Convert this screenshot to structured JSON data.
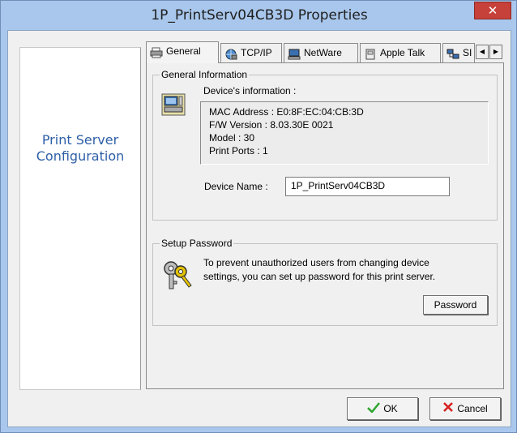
{
  "window": {
    "title": "1P_PrintServ04CB3D Properties",
    "close_glyph": "✕"
  },
  "left_panel": {
    "line1": "Print Server",
    "line2": "Configuration"
  },
  "tabs": [
    {
      "label": "General",
      "icon": "printer-icon"
    },
    {
      "label": "TCP/IP",
      "icon": "network-globe-icon"
    },
    {
      "label": "NetWare",
      "icon": "computer-icon"
    },
    {
      "label": "Apple Talk",
      "icon": "apple-talk-icon"
    },
    {
      "label": "SI",
      "icon": "network-computers-icon"
    }
  ],
  "tab_scroll": {
    "left": "◀",
    "right": "▶"
  },
  "general_info": {
    "legend": "General Information",
    "device_info_label": "Device's information :",
    "lines": [
      "MAC Address : E0:8F:EC:04:CB:3D",
      "F/W Version : 8.03.30E 0021",
      "Model : 30",
      "Print Ports : 1"
    ],
    "device_name_label": "Device Name :",
    "device_name_value": "1P_PrintServ04CB3D"
  },
  "setup_password": {
    "legend": "Setup Password",
    "line1": "To prevent unauthorized users from changing device",
    "line2": "settings, you can set up password for this print server.",
    "password_button": "Password"
  },
  "footer": {
    "ok": "OK",
    "cancel": "Cancel"
  }
}
